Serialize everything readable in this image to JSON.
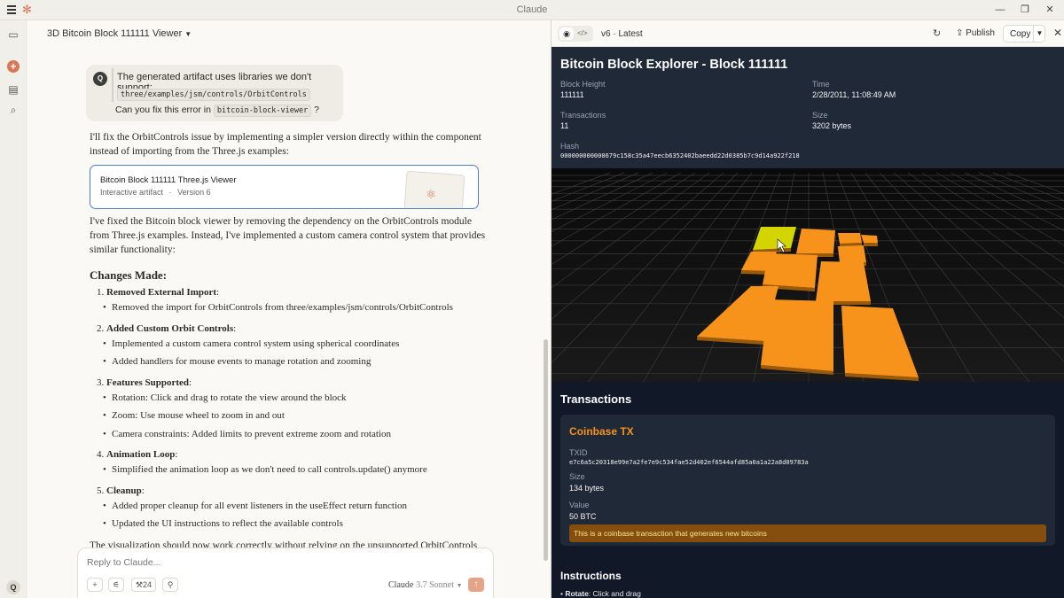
{
  "window": {
    "title": "Claude"
  },
  "chat": {
    "title": "3D Bitcoin Block 111111 Viewer",
    "user_avatar": "Q",
    "user_message": {
      "line1": "The generated artifact uses libraries we don't support:",
      "code1": "three/examples/jsm/controls/OrbitControls",
      "line3_pre": "Can you fix this error in",
      "code2": "bitcoin-block-viewer",
      "line3_post": "?"
    },
    "reply_intro": "I'll fix the OrbitControls issue by implementing a simpler version directly within the component instead of importing from the Three.js examples:",
    "artifact_card": {
      "title": "Bitcoin Block 111111 Three.js Viewer",
      "subtitle": "Interactive artifact",
      "version": "Version 6"
    },
    "reply_para2": "I've fixed the Bitcoin block viewer by removing the dependency on the OrbitControls module from Three.js examples. Instead, I've implemented a custom camera control system that provides similar functionality:",
    "changes_heading": "Changes Made:",
    "changes": [
      {
        "num": "1.",
        "title": "Removed External Import",
        "items": [
          "Removed the import for OrbitControls from three/examples/jsm/controls/OrbitControls"
        ]
      },
      {
        "num": "2.",
        "title": "Added Custom Orbit Controls",
        "items": [
          "Implemented a custom camera control system using spherical coordinates",
          "Added handlers for mouse events to manage rotation and zooming"
        ]
      },
      {
        "num": "3.",
        "title": "Features Supported",
        "items": [
          "Rotation: Click and drag to rotate the view around the block",
          "Zoom: Use mouse wheel to zoom in and out",
          "Camera constraints: Added limits to prevent extreme zoom and rotation"
        ]
      },
      {
        "num": "4.",
        "title": "Animation Loop",
        "items": [
          "Simplified the animation loop as we don't need to call controls.update() anymore"
        ]
      },
      {
        "num": "5.",
        "title": "Cleanup",
        "items": [
          "Added proper cleanup for all event listeners in the useEffect return function",
          "Updated the UI instructions to reflect the available controls"
        ]
      }
    ],
    "reply_tail": "The visualization should now work correctly without relying on the unsupported OrbitControls",
    "input_placeholder": "Reply to Claude...",
    "tools_count": "24",
    "model_name": "Claude",
    "model_version": "3.7 Sonnet",
    "rail_avatar": "Q"
  },
  "panel": {
    "version_label": "v6 · Latest",
    "publish_label": "Publish",
    "copy_label": "Copy",
    "block": {
      "title": "Bitcoin Block Explorer - Block 111111",
      "height_label": "Block Height",
      "height": "111111",
      "time_label": "Time",
      "time": "2/28/2011, 11:08:49 AM",
      "tx_label": "Transactions",
      "tx": "11",
      "size_label": "Size",
      "size": "3202 bytes",
      "hash_label": "Hash",
      "hash": "000000000000679c158c35a47eecb6352402baeedd22d0385b7c9d14a922f218"
    },
    "transactions_heading": "Transactions",
    "coinbase": {
      "title": "Coinbase TX",
      "txid_label": "TXID",
      "txid": "e7c6a5c20318e99e7a2fe7e9c534fae52d402ef6544afd85a0a1a22a8d09783a",
      "size_label": "Size",
      "size": "134 bytes",
      "value_label": "Value",
      "value": "50 BTC",
      "note": "This is a coinbase transaction that generates new bitcoins"
    },
    "instructions_heading": "Instructions",
    "instr_rotate_label": "Rotate",
    "instr_rotate_text": ": Click and drag"
  },
  "colors": {
    "accent": "#d97757",
    "bitcoin_orange": "#f7931a",
    "selected_tile": "#d4d400"
  }
}
